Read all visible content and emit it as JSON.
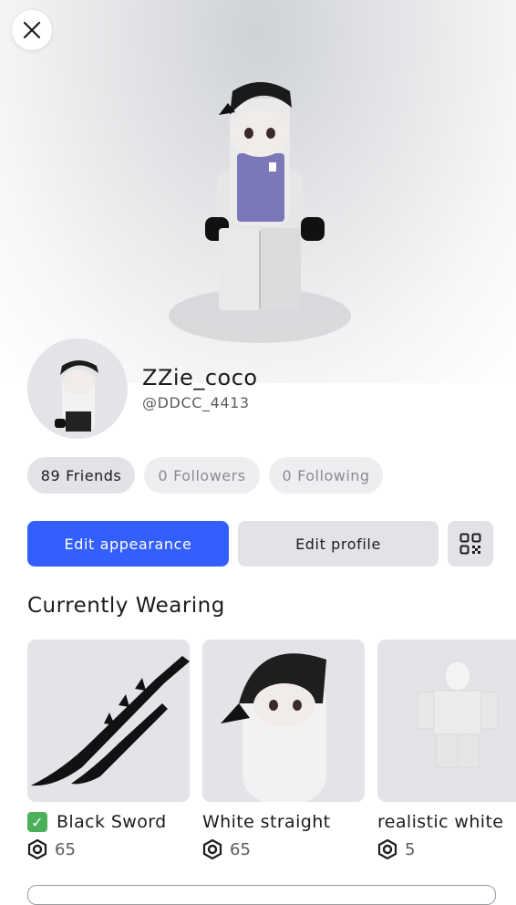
{
  "profile": {
    "display_name": "ZZie_coco",
    "username": "@DDCC_4413"
  },
  "stats": {
    "friends": {
      "count": "89",
      "label": "Friends"
    },
    "followers": {
      "count": "0",
      "label": "Followers"
    },
    "following": {
      "count": "0",
      "label": "Following"
    }
  },
  "actions": {
    "edit_appearance": "Edit appearance",
    "edit_profile": "Edit profile"
  },
  "wearing": {
    "title": "Currently Wearing",
    "items": [
      {
        "name": "Black Sword",
        "price": "65",
        "owned_check": "✓"
      },
      {
        "name": "White straight",
        "price": "65"
      },
      {
        "name": "realistic white",
        "price": "5"
      }
    ]
  },
  "icons": {
    "close": "close-icon",
    "qr": "qr-code-icon",
    "robux": "robux-icon",
    "check": "checkmark-icon"
  },
  "colors": {
    "accent": "#335fff",
    "chip_bg": "#e2e3e7",
    "check_green": "#4cb05b"
  }
}
